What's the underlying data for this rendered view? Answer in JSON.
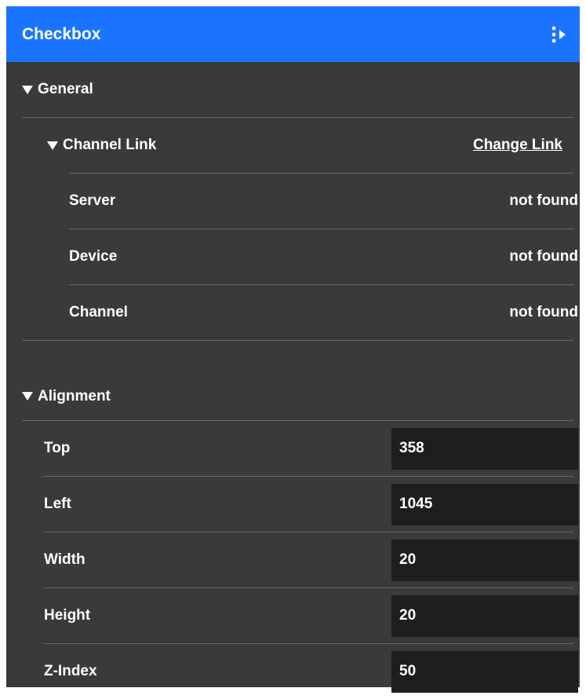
{
  "header": {
    "title": "Checkbox",
    "menu_icon": "more-options-icon"
  },
  "general": {
    "title": "General",
    "channel_link": {
      "title": "Channel Link",
      "change_link_label": "Change Link",
      "rows": [
        {
          "key": "Server",
          "value": "not found"
        },
        {
          "key": "Device",
          "value": "not found"
        },
        {
          "key": "Channel",
          "value": "not found"
        }
      ]
    }
  },
  "alignment": {
    "title": "Alignment",
    "fields": [
      {
        "key": "Top",
        "value": "358"
      },
      {
        "key": "Left",
        "value": "1045"
      },
      {
        "key": "Width",
        "value": "20"
      },
      {
        "key": "Height",
        "value": "20"
      },
      {
        "key": "Z-Index",
        "value": "50"
      }
    ]
  },
  "colors": {
    "header_bg": "#1b74ff",
    "panel_bg": "#3a3a3a",
    "field_bg": "#1e1e1e",
    "text": "#ffffff"
  }
}
